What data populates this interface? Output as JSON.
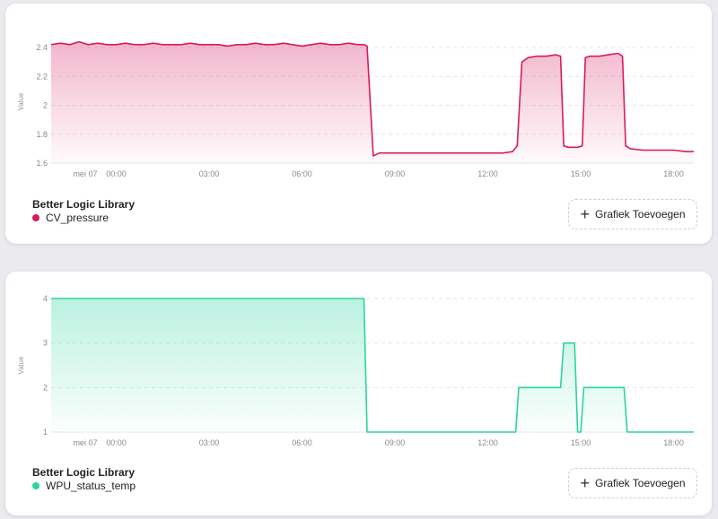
{
  "cards": [
    {
      "footer_title": "Better Logic Library",
      "legend_label": "CV_pressure",
      "add_button_label": "Grafiek Toevoegen"
    },
    {
      "footer_title": "Better Logic Library",
      "legend_label": "WPU_status_temp",
      "add_button_label": "Grafiek Toevoegen"
    }
  ],
  "chart_data": [
    {
      "type": "area",
      "ylabel": "Value",
      "ylim": [
        1.6,
        2.45
      ],
      "yticks": [
        1.6,
        1.8,
        2,
        2.2,
        2.4
      ],
      "xlim": [
        -2.1,
        18.65
      ],
      "xtick_labels": [
        "mei 07",
        "00:00",
        "03:00",
        "06:00",
        "09:00",
        "12:00",
        "15:00",
        "18:00"
      ],
      "xtick_positions": [
        -1,
        0,
        3,
        6,
        9,
        12,
        15,
        18
      ],
      "grid": "horizontal dashed",
      "color": "#d81b60",
      "series": [
        {
          "name": "CV_pressure",
          "x": [
            -2.1,
            -1.8,
            -1.5,
            -1.2,
            -0.9,
            -0.6,
            -0.3,
            0,
            0.3,
            0.6,
            0.9,
            1.2,
            1.5,
            1.8,
            2.1,
            2.4,
            2.7,
            3.0,
            3.3,
            3.6,
            3.9,
            4.2,
            4.5,
            4.8,
            5.1,
            5.4,
            5.7,
            6.0,
            6.3,
            6.6,
            6.9,
            7.2,
            7.5,
            7.8,
            8.0,
            8.1,
            8.3,
            8.5,
            9.5,
            11.0,
            12.5,
            12.8,
            12.95,
            13.1,
            13.3,
            13.6,
            13.9,
            14.2,
            14.35,
            14.45,
            14.6,
            14.9,
            15.05,
            15.15,
            15.3,
            15.6,
            15.9,
            16.2,
            16.35,
            16.45,
            16.6,
            17.0,
            17.5,
            18.0,
            18.4,
            18.65
          ],
          "y": [
            2.42,
            2.43,
            2.42,
            2.44,
            2.42,
            2.43,
            2.42,
            2.42,
            2.43,
            2.42,
            2.42,
            2.43,
            2.42,
            2.42,
            2.42,
            2.43,
            2.42,
            2.42,
            2.42,
            2.41,
            2.42,
            2.42,
            2.43,
            2.42,
            2.42,
            2.43,
            2.42,
            2.41,
            2.42,
            2.43,
            2.42,
            2.42,
            2.43,
            2.42,
            2.42,
            2.41,
            1.65,
            1.67,
            1.67,
            1.67,
            1.67,
            1.68,
            1.72,
            2.3,
            2.33,
            2.34,
            2.34,
            2.35,
            2.34,
            1.72,
            1.71,
            1.71,
            1.72,
            2.33,
            2.34,
            2.34,
            2.35,
            2.36,
            2.34,
            1.72,
            1.7,
            1.69,
            1.69,
            1.69,
            1.68,
            1.68
          ]
        }
      ]
    },
    {
      "type": "area",
      "ylabel": "Value",
      "ylim": [
        1,
        4
      ],
      "yticks": [
        1,
        2,
        3,
        4
      ],
      "xlim": [
        -2.1,
        18.65
      ],
      "xtick_labels": [
        "mei 07",
        "00:00",
        "03:00",
        "06:00",
        "09:00",
        "12:00",
        "15:00",
        "18:00"
      ],
      "xtick_positions": [
        -1,
        0,
        3,
        6,
        9,
        12,
        15,
        18
      ],
      "grid": "horizontal dashed",
      "color": "#2bd4a0",
      "series": [
        {
          "name": "WPU_status_temp",
          "x": [
            -2.1,
            8.0,
            8.1,
            12.9,
            13.0,
            14.35,
            14.45,
            14.8,
            14.9,
            15.0,
            15.1,
            16.4,
            16.5,
            18.65
          ],
          "y": [
            4,
            4,
            1,
            1,
            2,
            2,
            3,
            3,
            1,
            1,
            2,
            2,
            1,
            1
          ]
        }
      ]
    }
  ]
}
